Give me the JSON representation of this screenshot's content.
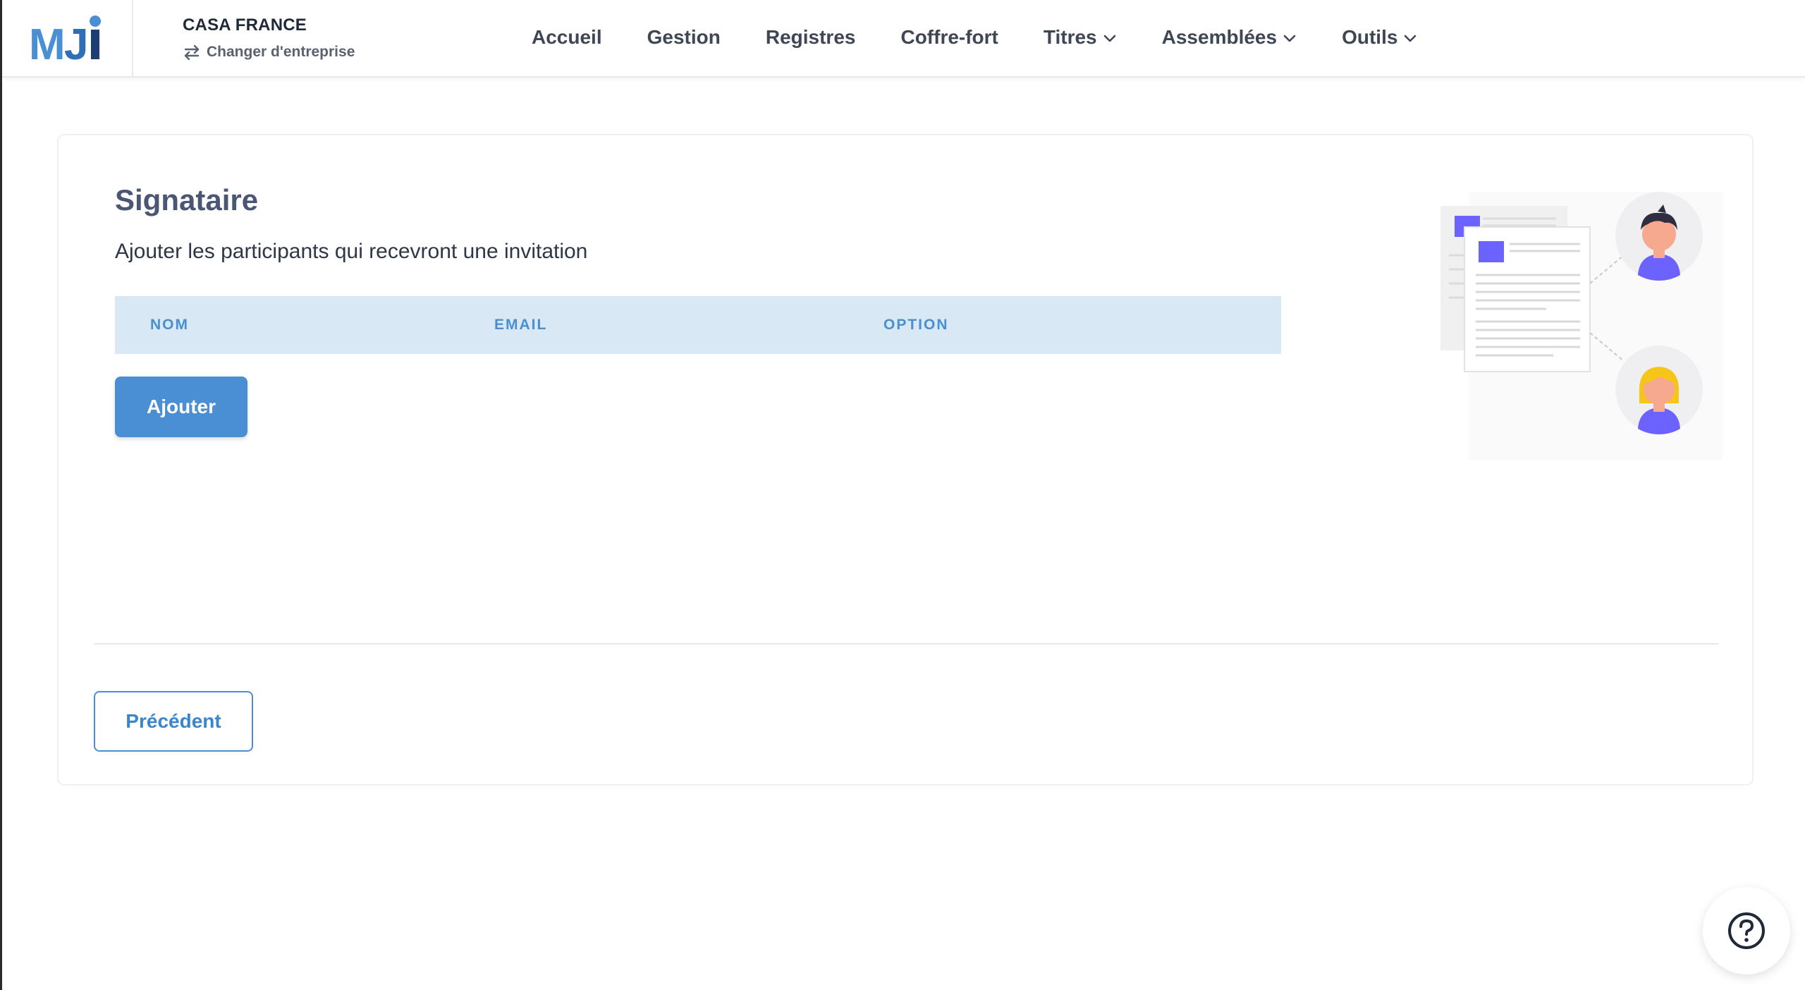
{
  "header": {
    "company_name": "CASA FRANCE",
    "switch_company_label": "Changer d'entreprise",
    "nav": [
      {
        "label": "Accueil",
        "has_dropdown": false
      },
      {
        "label": "Gestion",
        "has_dropdown": false
      },
      {
        "label": "Registres",
        "has_dropdown": false
      },
      {
        "label": "Coffre-fort",
        "has_dropdown": false
      },
      {
        "label": "Titres",
        "has_dropdown": true
      },
      {
        "label": "Assemblées",
        "has_dropdown": true
      },
      {
        "label": "Outils",
        "has_dropdown": true
      }
    ]
  },
  "main": {
    "title": "Signataire",
    "subtitle": "Ajouter les participants qui recevront une invitation",
    "table": {
      "columns": [
        "NOM",
        "EMAIL",
        "OPTION"
      ],
      "rows": []
    },
    "add_button_label": "Ajouter",
    "previous_button_label": "Précédent"
  },
  "colors": {
    "primary": "#4a8fd4",
    "table_header_bg": "#d9e8f5",
    "title": "#4a5673",
    "illustration_accent": "#6c63ff"
  },
  "icons": {
    "switch": "swap-arrows-icon",
    "dropdown": "chevron-down-icon",
    "help": "question-circle-icon"
  }
}
